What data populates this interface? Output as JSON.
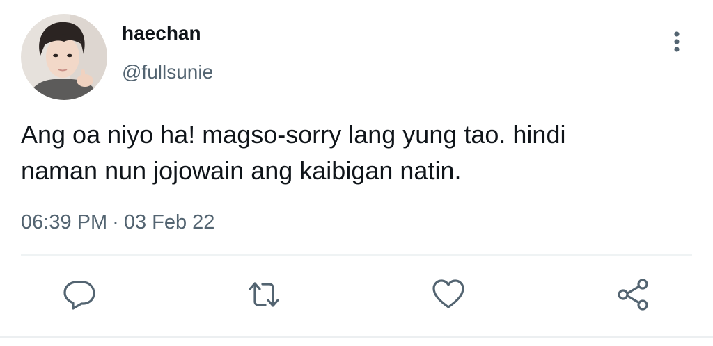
{
  "user": {
    "display_name": "haechan",
    "handle": "@fullsunie"
  },
  "tweet": {
    "text_lines": [
      "Ang oa niyo ha! magso-sorry lang yung tao. hindi",
      "naman nun jojowain ang kaibigan natin."
    ],
    "time": "06:39 PM",
    "separator": "·",
    "date": "03 Feb 22"
  },
  "icons": {
    "more": "vertical-ellipsis-icon",
    "reply": "reply-bubble-icon",
    "retweet": "retweet-arrows-icon",
    "like": "heart-icon",
    "share": "share-nodes-icon"
  },
  "colors": {
    "text_primary": "#0f1419",
    "text_secondary": "#536471",
    "icon": "#536471",
    "divider": "#eff3f4"
  }
}
